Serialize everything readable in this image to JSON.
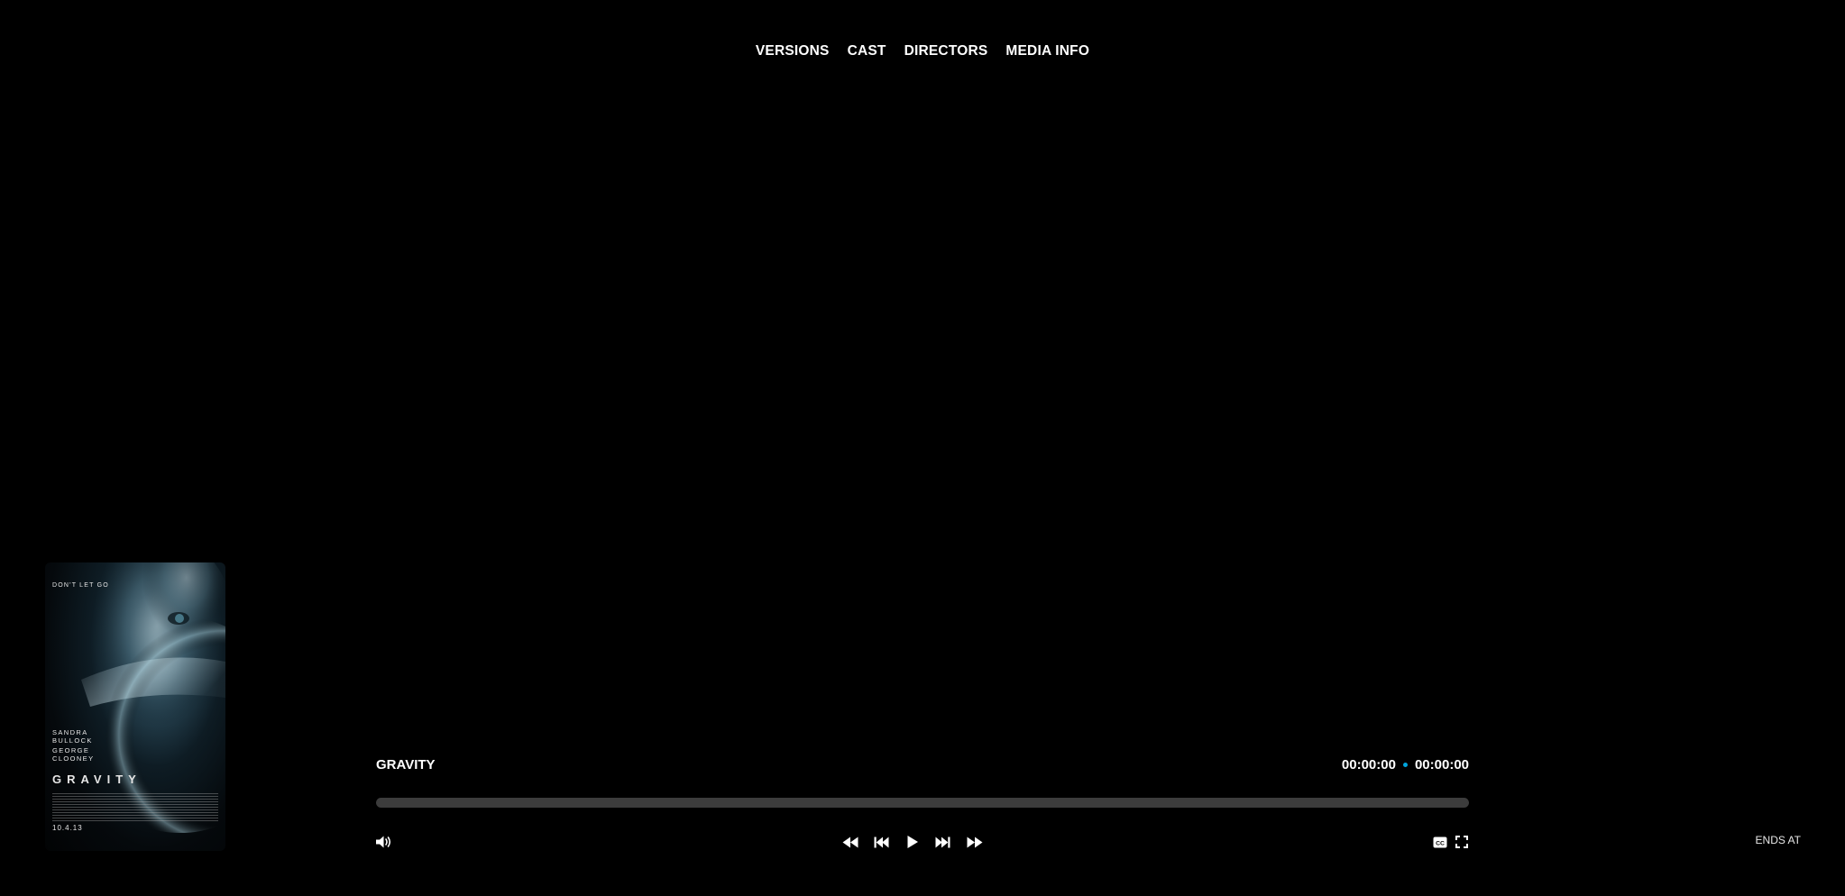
{
  "nav": {
    "items": [
      "VERSIONS",
      "CAST",
      "DIRECTORS",
      "MEDIA INFO"
    ]
  },
  "poster": {
    "tagline": "DON'T LET GO",
    "actor1_line1": "SANDRA",
    "actor1_line2": "BULLOCK",
    "actor2_line1": "GEORGE",
    "actor2_line2": "CLOONEY",
    "title": "GRAVITY",
    "date": "10.4.13"
  },
  "player": {
    "title": "GRAVITY",
    "current_time": "00:00:00",
    "total_time": "00:00:00",
    "progress": 0,
    "ends_at_label": "ENDS AT"
  },
  "icons": {
    "volume": "volume-icon",
    "rewind": "rewind-icon",
    "previous": "skip-previous-icon",
    "play": "play-icon",
    "next": "skip-next-icon",
    "fast_forward": "fast-forward-icon",
    "subtitles": "closed-captions-icon",
    "fullscreen": "fullscreen-icon"
  },
  "colors": {
    "background": "#000000",
    "accent": "#00a4dc",
    "track": "#3c3c3c",
    "text": "#ffffff"
  }
}
